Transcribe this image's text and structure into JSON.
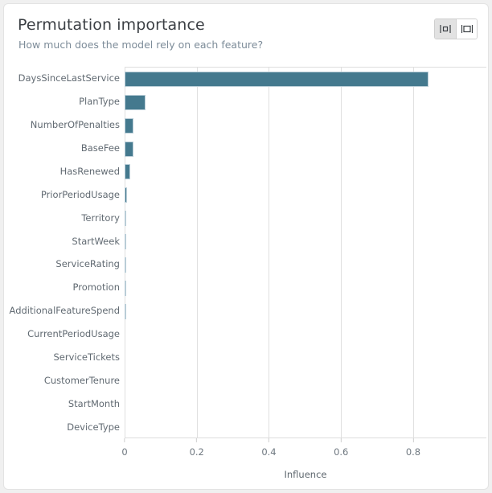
{
  "card": {
    "title": "Permutation importance",
    "subtitle": "How much does the model rely on each feature?"
  },
  "toolbar": {
    "buttons": [
      {
        "name": "compact-view-toggle",
        "icon": "compact-layout-icon",
        "active": true
      },
      {
        "name": "wide-view-toggle",
        "icon": "wide-layout-icon",
        "active": false
      }
    ]
  },
  "chart_data": {
    "type": "bar",
    "orientation": "horizontal",
    "title": "Permutation importance",
    "subtitle": "How much does the model rely on each feature?",
    "xlabel": "Influence",
    "ylabel": "",
    "xlim": [
      0,
      1.0028
    ],
    "xticks": [
      0,
      0.2,
      0.4,
      0.6,
      0.8
    ],
    "xtick_labels": [
      "0",
      "0.2",
      "0.4",
      "0.6",
      "0.8"
    ],
    "grid": "vertical",
    "legend": "none",
    "bar_color": "#44798e",
    "bar_edge_color": "#b9cdd7",
    "categories": [
      "DaysSinceLastService",
      "PlanType",
      "NumberOfPenalties",
      "BaseFee",
      "HasRenewed",
      "PriorPeriodUsage",
      "Territory",
      "StartWeek",
      "ServiceRating",
      "Promotion",
      "AdditionalFeatureSpend",
      "CurrentPeriodUsage",
      "ServiceTickets",
      "CustomerTenure",
      "StartMonth",
      "DeviceType"
    ],
    "values": [
      0.842,
      0.058,
      0.025,
      0.024,
      0.015,
      0.007,
      0.005,
      0.005,
      0.004,
      0.003,
      0.002,
      0.0,
      0.0,
      0.0,
      0.0,
      0.0
    ]
  }
}
